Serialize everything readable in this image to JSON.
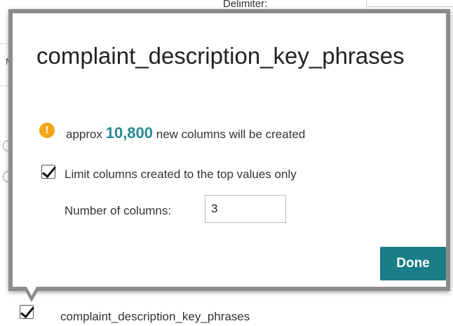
{
  "background": {
    "delimiter_label": "Delimiter:",
    "letter_m": "M"
  },
  "dialog": {
    "title": "complaint_description_key_phrases",
    "info": {
      "icon": "warning-icon",
      "icon_glyph": "!",
      "prefix": "approx",
      "count": "10,800",
      "suffix": "new columns will be created",
      "accent_color": "#2a8a92"
    },
    "limit_checkbox": {
      "checked": true,
      "label": "Limit columns created to the top values only"
    },
    "num_columns": {
      "label": "Number of columns:",
      "value": "3"
    },
    "done_label": "Done",
    "button_color": "#1a7d87"
  },
  "column_row": {
    "checked": true,
    "label": "complaint_description_key_phrases"
  }
}
